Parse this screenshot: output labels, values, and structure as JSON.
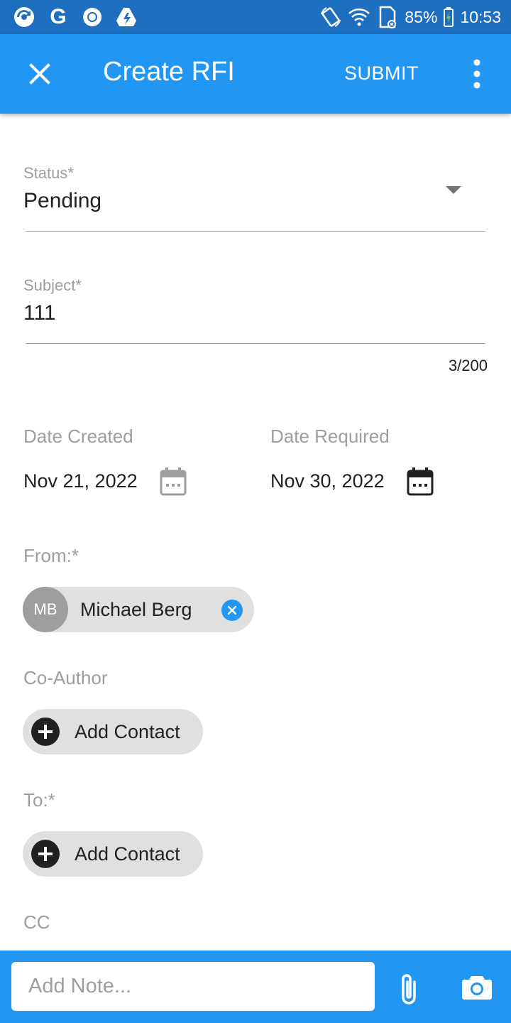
{
  "status_bar": {
    "battery": "85%",
    "time": "10:53",
    "icons": [
      "app-icon",
      "google-icon",
      "chrome-icon",
      "drive-icon",
      "rotate-icon",
      "wifi-icon",
      "sim-icon",
      "battery-icon"
    ]
  },
  "app_bar": {
    "title": "Create RFI",
    "submit_label": "SUBMIT",
    "close_icon": "close-icon",
    "more_icon": "more-vert-icon",
    "color": "#2196F3"
  },
  "form": {
    "status": {
      "label": "Status*",
      "value": "Pending"
    },
    "subject": {
      "label": "Subject*",
      "value": "111",
      "counter": "3/200"
    },
    "date_created": {
      "label": "Date Created",
      "value": "Nov 21, 2022"
    },
    "date_required": {
      "label": "Date Required",
      "value": "Nov 30, 2022"
    },
    "from": {
      "label": "From:*",
      "chip": {
        "initials": "MB",
        "name": "Michael Berg"
      }
    },
    "co_author": {
      "label": "Co-Author",
      "add_label": "Add Contact"
    },
    "to": {
      "label": "To:*",
      "add_label": "Add Contact"
    },
    "cc": {
      "label": "CC"
    }
  },
  "bottom_bar": {
    "note_placeholder": "Add Note...",
    "attach_icon": "paperclip-icon",
    "camera_icon": "camera-icon"
  }
}
